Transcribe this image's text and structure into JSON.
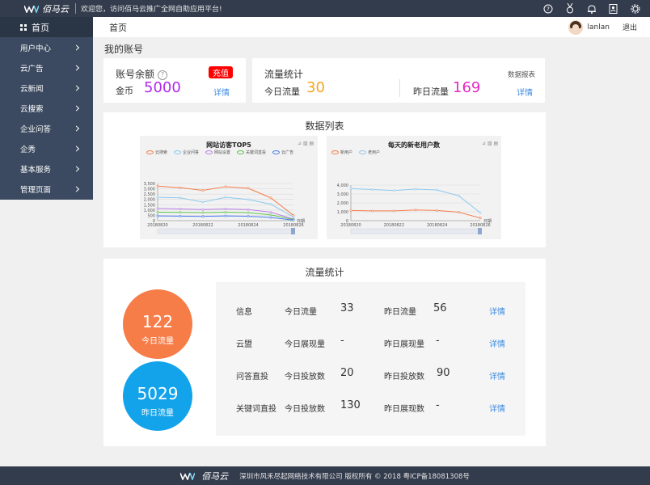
{
  "topbar": {
    "logo_text": "佰马云",
    "welcome": "欢迎您，访问佰马云推广全网自助应用平台!",
    "icons": [
      "help-icon",
      "medal-icon",
      "bell-icon",
      "contacts-icon",
      "settings-icon"
    ]
  },
  "sidebar": {
    "home": "首页",
    "items": [
      {
        "label": "用户中心"
      },
      {
        "label": "云广告"
      },
      {
        "label": "云新闻"
      },
      {
        "label": "云搜索"
      },
      {
        "label": "企业问答"
      },
      {
        "label": "企秀"
      },
      {
        "label": "基本服务"
      },
      {
        "label": "管理页面"
      }
    ]
  },
  "header": {
    "crumb": "首页",
    "username": "lanlan",
    "logout": "退出"
  },
  "account": {
    "section_title": "我的账号",
    "balance_title": "账号余额",
    "help_glyph": "?",
    "recharge": "充值",
    "coin_label": "金币",
    "coin_value": "5000",
    "detail": "详情"
  },
  "traffic_card": {
    "title": "流量统计",
    "report": "数据报表",
    "today_label": "今日流量",
    "today_value": "30",
    "yesterday_label": "昨日流量",
    "yesterday_value": "169",
    "detail": "详情"
  },
  "data_list": {
    "title": "数据列表",
    "chart1": {
      "title": "网站访客TOP5",
      "legend": [
        "云搜索",
        "企业问答",
        "网站设置",
        "关键词直投",
        "云广告"
      ],
      "x_ticks": [
        "20180820",
        "20180822",
        "20180824",
        "20180826"
      ],
      "y_ticks": [
        "0",
        "500",
        "1,000",
        "1,500",
        "2,000",
        "2,500",
        "3,000",
        "3,500"
      ],
      "x_unit": "日期"
    },
    "chart2": {
      "title": "每天的新老用户数",
      "legend": [
        "新用户",
        "老用户"
      ],
      "x_ticks": [
        "20180820",
        "20180822",
        "20180824",
        "20180826"
      ],
      "y_ticks": [
        "0",
        "1,000",
        "2,000",
        "3,000",
        "4,000"
      ],
      "x_unit": "日期"
    }
  },
  "chart_data": [
    {
      "type": "line",
      "title": "网站访客TOP5",
      "xlabel": "日期",
      "x": [
        "20180820",
        "20180821",
        "20180822",
        "20180823",
        "20180824",
        "20180825",
        "20180826"
      ],
      "ylim": [
        0,
        3500
      ],
      "series": [
        {
          "name": "云搜索",
          "color": "#f47c4a",
          "values": [
            3250,
            3100,
            2850,
            3200,
            3050,
            2150,
            500
          ]
        },
        {
          "name": "企业问答",
          "color": "#8cc8ec",
          "values": [
            2200,
            2150,
            1750,
            2200,
            2000,
            1550,
            350
          ]
        },
        {
          "name": "网站设置",
          "color": "#b97fe6",
          "values": [
            1150,
            1100,
            1050,
            1100,
            1050,
            800,
            150
          ]
        },
        {
          "name": "关键词直投",
          "color": "#5ec24a",
          "values": [
            800,
            780,
            760,
            800,
            750,
            550,
            100
          ]
        },
        {
          "name": "云广告",
          "color": "#4b7cf2",
          "values": [
            450,
            430,
            400,
            450,
            420,
            300,
            50
          ]
        }
      ]
    },
    {
      "type": "line",
      "title": "每天的新老用户数",
      "xlabel": "日期",
      "x": [
        "20180820",
        "20180821",
        "20180822",
        "20180823",
        "20180824",
        "20180825",
        "20180826"
      ],
      "ylim": [
        0,
        4000
      ],
      "series": [
        {
          "name": "新用户",
          "color": "#f47c4a",
          "values": [
            1150,
            1100,
            1100,
            1200,
            1150,
            950,
            300
          ]
        },
        {
          "name": "老用户",
          "color": "#8cc8ec",
          "values": [
            3600,
            3500,
            3400,
            3550,
            3450,
            2800,
            900
          ]
        }
      ]
    }
  ],
  "flow": {
    "title": "流量统计",
    "today_circle": {
      "value": "122",
      "label": "今日流量",
      "color": "#f67c48"
    },
    "yesterday_circle": {
      "value": "5029",
      "label": "昨日流量",
      "color": "#12a3ea"
    },
    "rows": [
      {
        "name": "信息",
        "l1": "今日流量",
        "v1": "33",
        "l2": "昨日流量",
        "v2": "56",
        "detail": "详情"
      },
      {
        "name": "云盟",
        "l1": "今日展现量",
        "v1": "-",
        "l2": "昨日展现量",
        "v2": "-",
        "detail": "详情"
      },
      {
        "name": "问答直投",
        "l1": "今日投放数",
        "v1": "20",
        "l2": "昨日投放数",
        "v2": "90",
        "detail": "详情"
      },
      {
        "name": "关键词直投",
        "l1": "今日投放数",
        "v1": "130",
        "l2": "昨日展现数",
        "v2": "-",
        "detail": "详情"
      }
    ]
  },
  "footer": {
    "logo_text": "佰马云",
    "text": "深圳市风禾尽起网络技术有限公司 版权所有 © 2018 粤ICP备18081308号"
  }
}
